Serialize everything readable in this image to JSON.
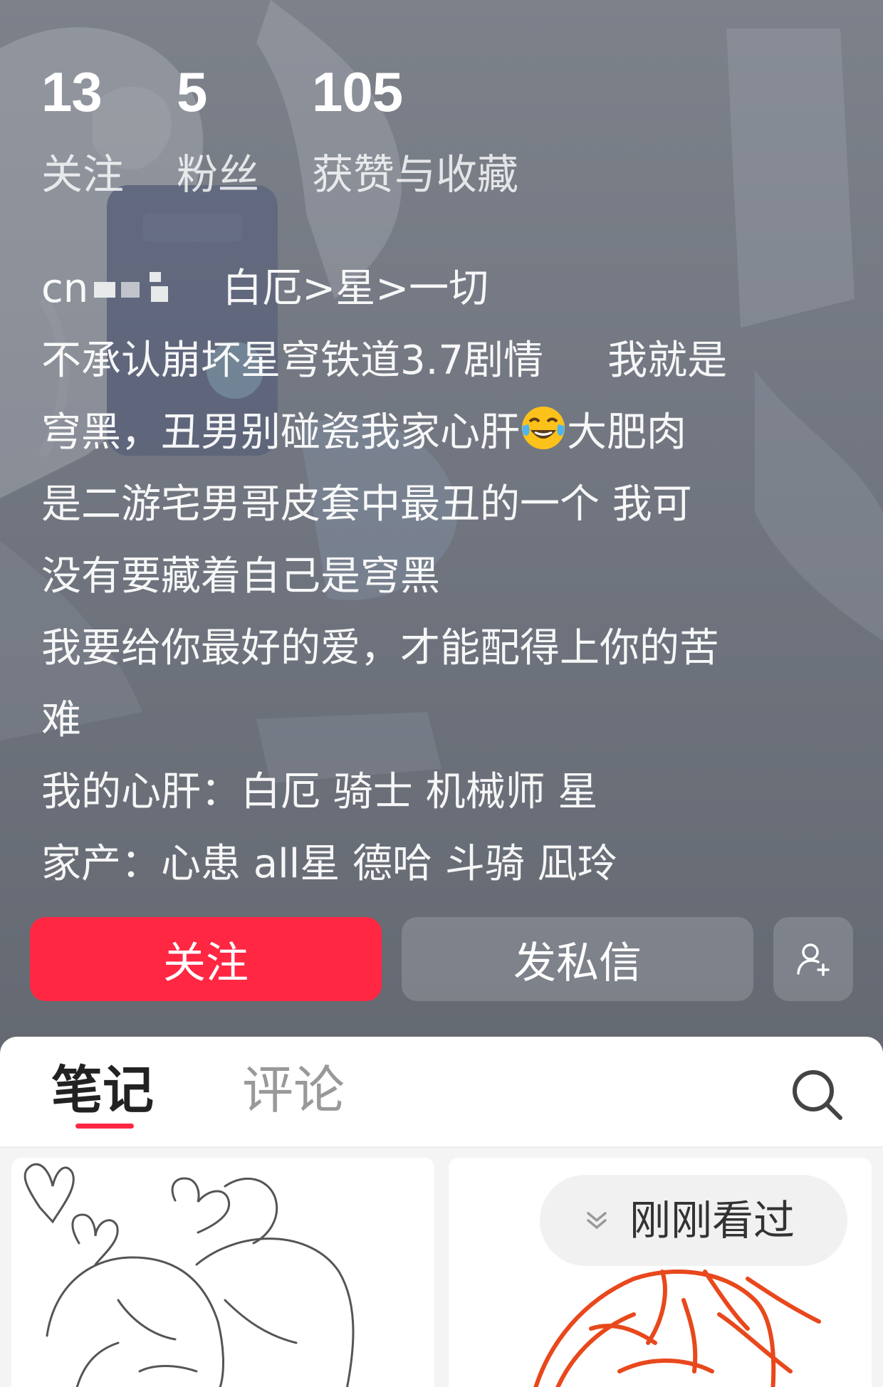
{
  "stats": [
    {
      "value": "13",
      "label": "关注"
    },
    {
      "value": "5",
      "label": "粉丝"
    },
    {
      "value": "105",
      "label": "获赞与收藏"
    }
  ],
  "bio": {
    "line1_prefix": "cn",
    "line1_rest": "白厄>星>一切",
    "line2": "不承认崩坏星穹铁道3.7剧情",
    "line2_tail": "我就是",
    "line3_a": "穹黑，丑男别碰瓷我家心肝",
    "line3_emoji": "face-with-tears-of-joy-emoji",
    "line3_b": "大肥肉",
    "line4": "是二游宅男哥皮套中最丑的一个  我可",
    "line5": "没有要藏着自己是穹黑",
    "line6": "我要给你最好的爱，才能配得上你的苦",
    "line7": "难",
    "line8": "我的心肝：白厄  骑士  机械师  星",
    "line9": "家产：心患   all星   德哈  斗骑  凪玲"
  },
  "actions": {
    "follow_label": "关注",
    "message_label": "发私信",
    "add_friend_icon": "person-add-icon",
    "follow_color": "#ff2742"
  },
  "tabs": [
    {
      "label": "笔记",
      "active": true
    },
    {
      "label": "评论",
      "active": false
    }
  ],
  "search_icon": "search-icon",
  "feed": {
    "just_viewed_label": "刚刚看过",
    "just_viewed_icon": "chevron-down-icon"
  }
}
